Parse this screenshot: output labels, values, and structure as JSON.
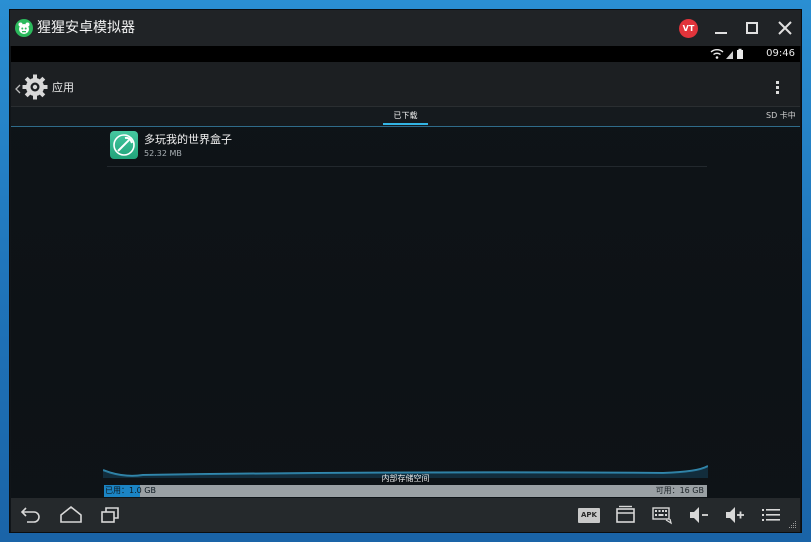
{
  "window": {
    "title": "猩猩安卓模拟器",
    "avatar_initials": "VT",
    "avatar_color": "#e2343b",
    "brand_color": "#2cba5d"
  },
  "statusbar": {
    "time": "09:46"
  },
  "actionbar": {
    "title": "应用"
  },
  "tabs": {
    "downloaded": "已下载",
    "sd_card": "SD 卡中"
  },
  "apps": [
    {
      "name": "多玩我的世界盒子",
      "size": "52.32 MB"
    }
  ],
  "storage": {
    "label": "内部存储空间",
    "used_text": "已用：1.0 GB",
    "free_text": "可用：16 GB",
    "used_fraction": 0.06
  },
  "navbar": {
    "apk_label": "APK",
    "icons": [
      "back-icon",
      "home-icon",
      "recent-apps-icon",
      "apk-icon",
      "window-icon",
      "keyboard-icon",
      "volume-down-icon",
      "volume-up-icon",
      "menu-icon"
    ]
  },
  "accent": "#33b5e5"
}
